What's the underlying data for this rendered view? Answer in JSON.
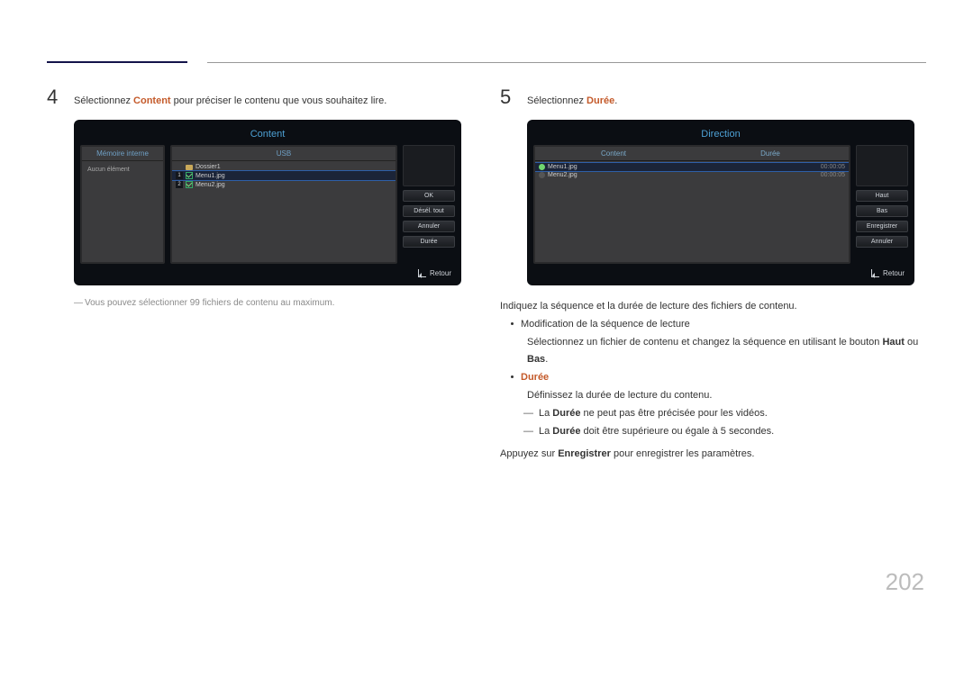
{
  "page_number": "202",
  "left": {
    "step_number": "4",
    "step_text_pre": "Sélectionnez ",
    "step_text_hl": "Content",
    "step_text_post": " pour préciser le contenu que vous souhaitez lire.",
    "panel": {
      "title": "Content",
      "tab_left": "Mémoire interne",
      "tab_right": "USB",
      "left_label": "Aucun élément",
      "folder_label": "Dossier1",
      "file1_num": "1",
      "file1": "Menu1.jpg",
      "file2_num": "2",
      "file2": "Menu2.jpg",
      "btn_ok": "OK",
      "btn_deselect": "Désél. tout",
      "btn_cancel": "Annuler",
      "btn_duration": "Durée",
      "return": "Retour"
    },
    "note": "Vous pouvez sélectionner 99 fichiers de contenu au maximum."
  },
  "right": {
    "step_number": "5",
    "step_text_pre": "Sélectionnez ",
    "step_text_hl": "Durée",
    "step_text_post": ".",
    "panel": {
      "title": "Direction",
      "tab_left": "Content",
      "tab_right": "Durée",
      "file1": "Menu1.jpg",
      "file1_dur": "00:00:05",
      "file2": "Menu2.jpg",
      "file2_dur": "00:00:05",
      "btn_up": "Haut",
      "btn_down": "Bas",
      "btn_save": "Enregistrer",
      "btn_cancel": "Annuler",
      "return": "Retour"
    },
    "l1": "Indiquez la séquence et la durée de lecture des fichiers de contenu.",
    "l2": "Modification de la séquence de lecture",
    "l3_pre": "Sélectionnez un fichier de contenu et changez la séquence en utilisant le bouton ",
    "l3_b1": "Haut",
    "l3_mid": " ou ",
    "l3_b2": "Bas",
    "l3_post": ".",
    "l4": "Durée",
    "l5": "Définissez la durée de lecture du contenu.",
    "l6_pre": "La ",
    "l6_b": "Durée",
    "l6_post": " ne peut pas être précisée pour les vidéos.",
    "l7_pre": "La ",
    "l7_b": "Durée",
    "l7_post": " doit être supérieure ou égale à 5 secondes.",
    "l8_pre": "Appuyez sur ",
    "l8_b": "Enregistrer",
    "l8_post": " pour enregistrer les paramètres."
  }
}
